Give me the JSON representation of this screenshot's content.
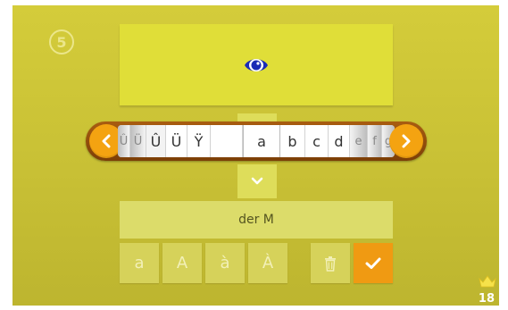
{
  "step": {
    "number": "5"
  },
  "prompt": {
    "icon": "eye-icon",
    "icon_color": "#1a2bb5",
    "background": "#e0de38"
  },
  "letter_drum": {
    "cells": [
      "Û",
      "Ü",
      "Û",
      "Ü",
      "Ÿ",
      "",
      "a",
      "b",
      "c",
      "d",
      "e",
      "f",
      "g"
    ],
    "selected": "a",
    "arrow_color": "#f4a311",
    "scroll_left_icon": "chevron-left-icon",
    "scroll_right_icon": "chevron-right-icon",
    "expand_icon": "chevron-down-icon"
  },
  "answer": {
    "value": "der M"
  },
  "variant_keys": [
    "a",
    "A",
    "à",
    "À"
  ],
  "actions": {
    "delete_icon": "trash-icon",
    "confirm_icon": "check-icon",
    "confirm_color": "#f09a12"
  },
  "score": {
    "value": "18",
    "icon": "crown-icon",
    "icon_color": "#f6e24a"
  },
  "colors": {
    "background": "#c8c035",
    "accent": "#f4a311"
  }
}
